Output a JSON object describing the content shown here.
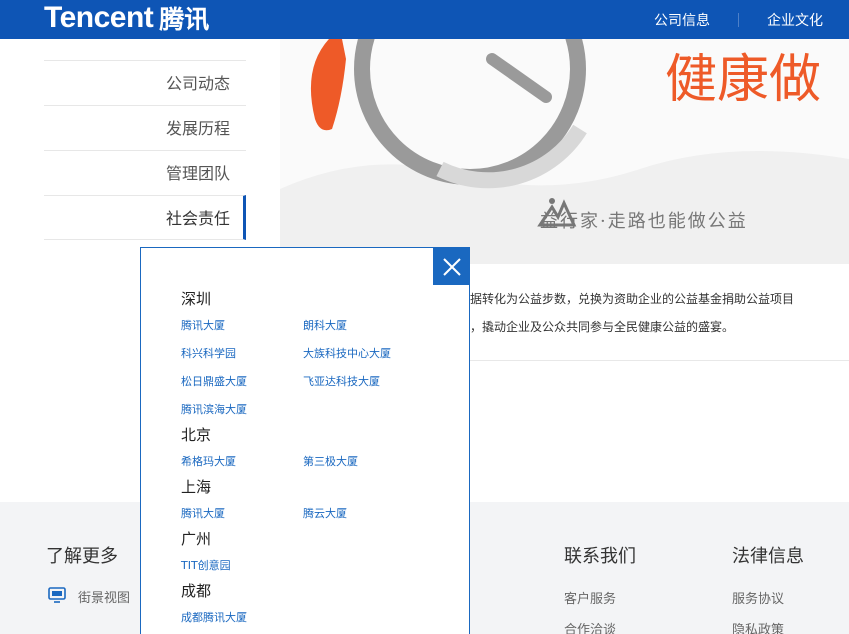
{
  "header": {
    "logo_en": "Tencent",
    "logo_cn": "腾讯",
    "nav": [
      "公司信息",
      "企业文化"
    ]
  },
  "menu": {
    "items": [
      "公司动态",
      "发展历程",
      "管理团队",
      "社会责任"
    ],
    "active": "社会责任"
  },
  "banner": {
    "big_text": "健康做",
    "tagline": "益行家·走路也能做公益"
  },
  "article": {
    "line1": "数据转化为公益步数，兑换为资助企业的公益基金捐助公益项目",
    "line2": "交，撬动企业及公众共同参与全民健康公益的盛宴。"
  },
  "footer": {
    "learn_more": "了解更多",
    "street_view": "街景视图",
    "contact": "联系我们",
    "contact_links": [
      "客户服务",
      "合作洽谈"
    ],
    "legal": "法律信息",
    "legal_links": [
      "服务协议",
      "隐私政策"
    ]
  },
  "popup": {
    "close_icon": "close-icon",
    "cities": [
      {
        "name": "深圳",
        "buildings": [
          "腾讯大厦",
          "朗科大厦",
          "科兴科学园",
          "大族科技中心大厦",
          "松日鼎盛大厦",
          "飞亚达科技大厦",
          "腾讯滨海大厦"
        ]
      },
      {
        "name": "北京",
        "buildings": [
          "希格玛大厦",
          "第三极大厦"
        ]
      },
      {
        "name": "上海",
        "buildings": [
          "腾讯大厦",
          "腾云大厦"
        ]
      },
      {
        "name": "广州",
        "buildings": [
          "TIT创意园"
        ]
      },
      {
        "name": "成都",
        "buildings": [
          "成都腾讯大厦"
        ]
      }
    ]
  },
  "colors": {
    "brand_blue": "#0e55b5",
    "link_blue": "#1a68c0",
    "banner_orange": "#ee5a28",
    "footer_bg": "#f3f4f6"
  }
}
